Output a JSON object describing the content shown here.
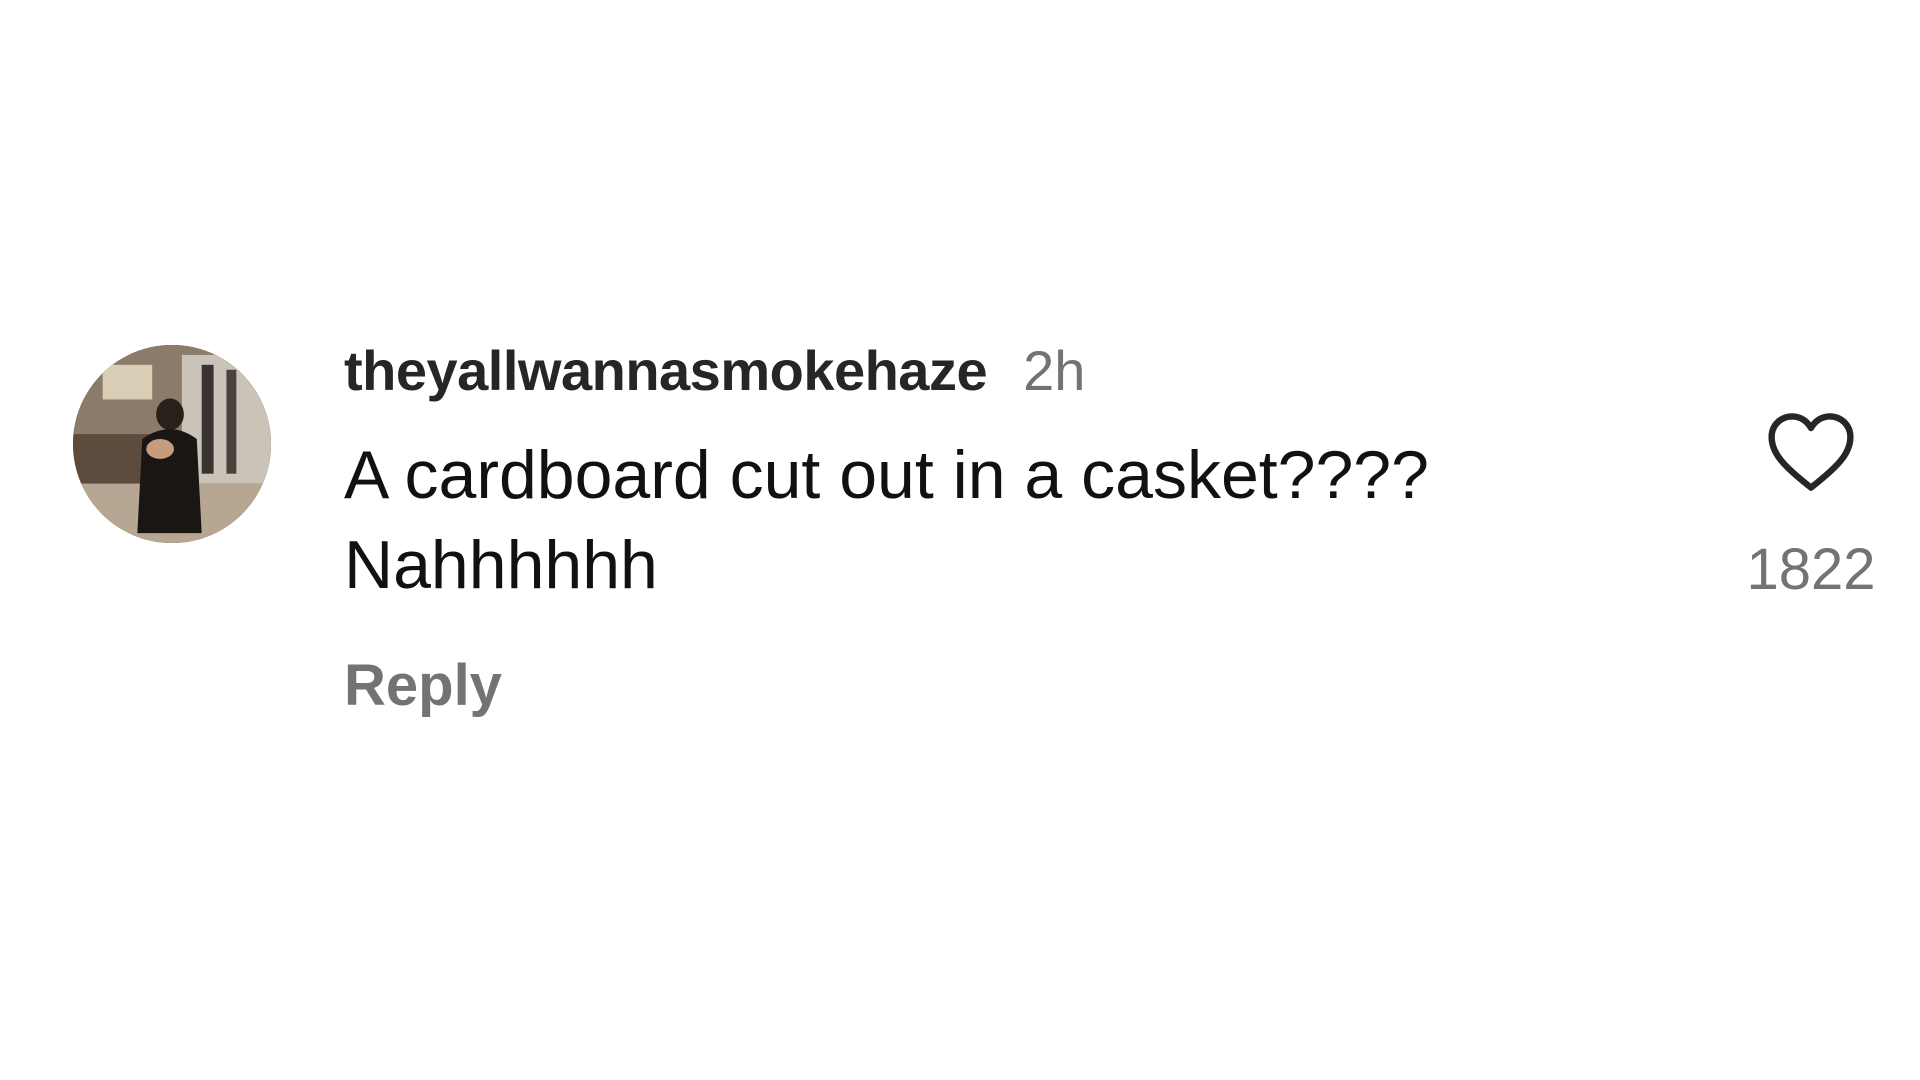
{
  "comment": {
    "username": "theyallwannasmokehaze",
    "time": "2h",
    "text": "A cardboard cut out in a casket????\nNahhhhhh",
    "reply_label": "Reply",
    "like_count": "1822",
    "avatar_icon": "profile-photo",
    "like_icon": "heart-outline-icon"
  },
  "colors": {
    "username": "#262626",
    "meta": "#737373",
    "text": "#111111",
    "background": "#ffffff"
  }
}
